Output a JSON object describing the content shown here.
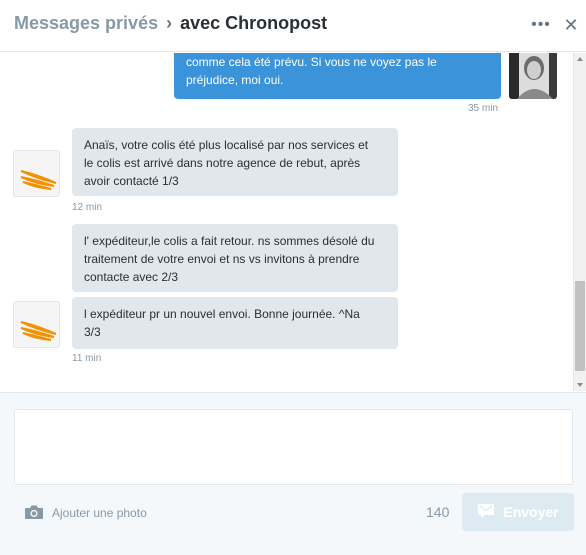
{
  "header": {
    "breadcrumb": "Messages privés",
    "separator": "›",
    "conversation_title": "avec Chronopost",
    "more_icon": "more-icon",
    "close_icon": "close-icon"
  },
  "messages": [
    {
      "direction": "sent",
      "lines": [
        "comme cela été prévu. Si vous ne voyez pas le",
        "préjudice, moi oui."
      ],
      "time": "35 min"
    },
    {
      "direction": "received",
      "lines": [
        "Anaïs, votre colis été plus localisé par nos services et",
        "le colis est arrivé dans notre agence de rebut, après",
        "avoir contacté 1/3"
      ],
      "time": "12 min"
    },
    {
      "direction": "received",
      "lines": [
        "l' expéditeur,le colis a fait retour. ns sommes désolé du",
        "traitement de votre envoi et ns vs invitons à prendre",
        "contacte avec 2/3"
      ],
      "time": ""
    },
    {
      "direction": "received",
      "lines": [
        "l expéditeur pr un nouvel envoi. Bonne journée. ^Na",
        "3/3"
      ],
      "time": "11 min"
    }
  ],
  "composer": {
    "placeholder": "",
    "add_photo_label": "Ajouter une photo",
    "char_count": "140",
    "send_label": "Envoyer"
  },
  "colors": {
    "sent_bubble": "#3b94d9",
    "received_bubble": "#e1e8ed",
    "brand_orange": "#f39200",
    "send_disabled": "#ddeaf2"
  }
}
